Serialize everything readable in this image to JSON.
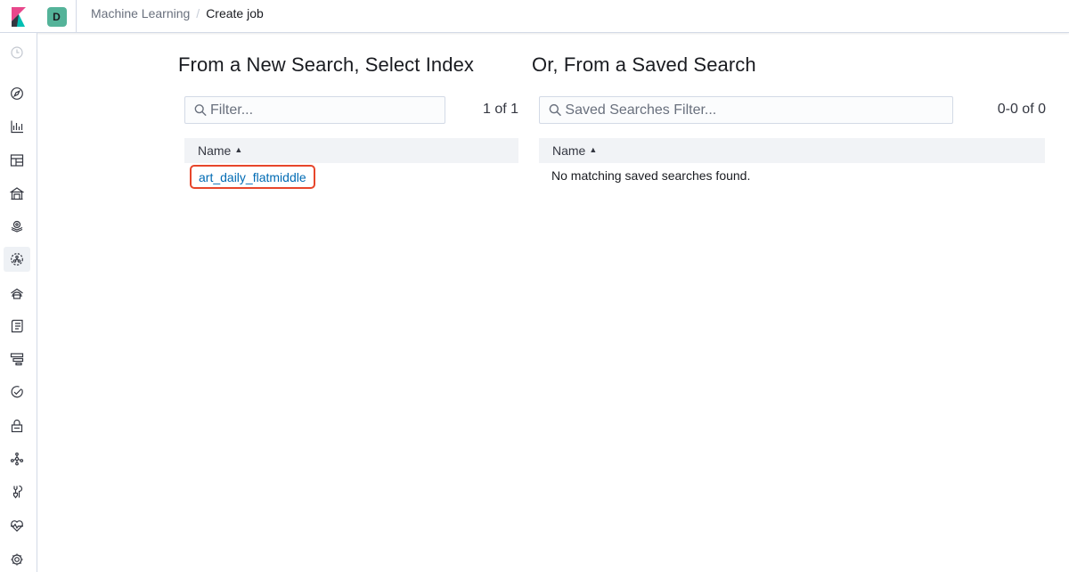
{
  "header": {
    "space_initial": "D",
    "breadcrumbs": [
      "Machine Learning",
      "Create job"
    ]
  },
  "sidebar": {
    "items": [
      {
        "icon": "clock-icon"
      },
      {
        "icon": "compass-icon"
      },
      {
        "icon": "visualize-icon"
      },
      {
        "icon": "dashboard-icon"
      },
      {
        "icon": "canvas-icon"
      },
      {
        "icon": "maps-icon"
      },
      {
        "icon": "machine-learning-icon"
      },
      {
        "icon": "infrastructure-icon"
      },
      {
        "icon": "logs-icon"
      },
      {
        "icon": "apm-icon"
      },
      {
        "icon": "uptime-icon"
      },
      {
        "icon": "siem-icon"
      },
      {
        "icon": "graph-icon"
      },
      {
        "icon": "dev-tools-icon"
      },
      {
        "icon": "monitoring-icon"
      },
      {
        "icon": "management-gear-icon"
      }
    ]
  },
  "index_panel": {
    "title": "From a New Search, Select Index",
    "filter_placeholder": "Filter...",
    "count": "1 of 1",
    "column_name": "Name",
    "rows": [
      "art_daily_flatmiddle"
    ]
  },
  "saved_panel": {
    "title": "Or, From a Saved Search",
    "filter_placeholder": "Saved Searches Filter...",
    "count": "0-0 of 0",
    "column_name": "Name",
    "empty_message": "No matching saved searches found."
  },
  "colors": {
    "accent_link": "#006bb4",
    "highlight_border": "#e7462b",
    "space_avatar": "#54b399"
  }
}
